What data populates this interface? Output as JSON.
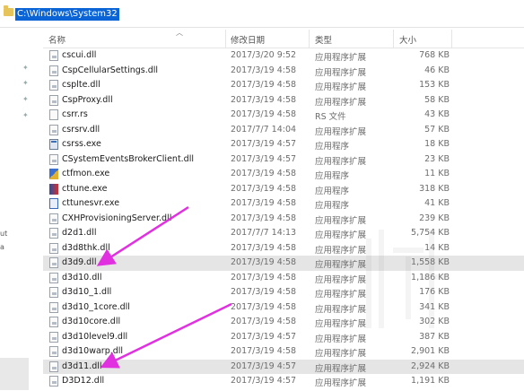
{
  "address": {
    "path": "C:\\Windows\\System32"
  },
  "columns": {
    "name": "名称",
    "date": "修改日期",
    "type": "类型",
    "size": "大小"
  },
  "left_marks": [
    "ut",
    "a"
  ],
  "rows": [
    {
      "name": "cscui.dll",
      "date": "2017/3/20 9:52",
      "type": "应用程序扩展",
      "size": "768 KB",
      "icon": "dll",
      "hl": false
    },
    {
      "name": "CspCellularSettings.dll",
      "date": "2017/3/19 4:58",
      "type": "应用程序扩展",
      "size": "46 KB",
      "icon": "dll",
      "hl": false
    },
    {
      "name": "csplte.dll",
      "date": "2017/3/19 4:58",
      "type": "应用程序扩展",
      "size": "153 KB",
      "icon": "dll",
      "hl": false
    },
    {
      "name": "CspProxy.dll",
      "date": "2017/3/19 4:58",
      "type": "应用程序扩展",
      "size": "58 KB",
      "icon": "dll",
      "hl": false
    },
    {
      "name": "csrr.rs",
      "date": "2017/3/19 4:58",
      "type": "RS 文件",
      "size": "43 KB",
      "icon": "file",
      "hl": false
    },
    {
      "name": "csrsrv.dll",
      "date": "2017/7/7 14:04",
      "type": "应用程序扩展",
      "size": "57 KB",
      "icon": "dll",
      "hl": false
    },
    {
      "name": "csrss.exe",
      "date": "2017/3/19 4:57",
      "type": "应用程序",
      "size": "18 KB",
      "icon": "exe",
      "hl": false
    },
    {
      "name": "CSystemEventsBrokerClient.dll",
      "date": "2017/3/19 4:57",
      "type": "应用程序扩展",
      "size": "23 KB",
      "icon": "dll",
      "hl": false
    },
    {
      "name": "ctfmon.exe",
      "date": "2017/3/19 4:58",
      "type": "应用程序",
      "size": "11 KB",
      "icon": "ctf",
      "hl": false
    },
    {
      "name": "cttune.exe",
      "date": "2017/3/19 4:58",
      "type": "应用程序",
      "size": "318 KB",
      "icon": "tune",
      "hl": false
    },
    {
      "name": "cttunesvr.exe",
      "date": "2017/3/19 4:58",
      "type": "应用程序",
      "size": "41 KB",
      "icon": "blue",
      "hl": false
    },
    {
      "name": "CXHProvisioningServer.dll",
      "date": "2017/3/19 4:58",
      "type": "应用程序扩展",
      "size": "239 KB",
      "icon": "dll",
      "hl": false
    },
    {
      "name": "d2d1.dll",
      "date": "2017/7/7 14:13",
      "type": "应用程序扩展",
      "size": "5,754 KB",
      "icon": "dll",
      "hl": false
    },
    {
      "name": "d3d8thk.dll",
      "date": "2017/3/19 4:58",
      "type": "应用程序扩展",
      "size": "14 KB",
      "icon": "dll",
      "hl": false
    },
    {
      "name": "d3d9.dll",
      "date": "2017/3/19 4:58",
      "type": "应用程序扩展",
      "size": "1,558 KB",
      "icon": "dll",
      "hl": true
    },
    {
      "name": "d3d10.dll",
      "date": "2017/3/19 4:58",
      "type": "应用程序扩展",
      "size": "1,186 KB",
      "icon": "dll",
      "hl": false
    },
    {
      "name": "d3d10_1.dll",
      "date": "2017/3/19 4:58",
      "type": "应用程序扩展",
      "size": "176 KB",
      "icon": "dll",
      "hl": false
    },
    {
      "name": "d3d10_1core.dll",
      "date": "2017/3/19 4:58",
      "type": "应用程序扩展",
      "size": "341 KB",
      "icon": "dll",
      "hl": false
    },
    {
      "name": "d3d10core.dll",
      "date": "2017/3/19 4:58",
      "type": "应用程序扩展",
      "size": "302 KB",
      "icon": "dll",
      "hl": false
    },
    {
      "name": "d3d10level9.dll",
      "date": "2017/3/19 4:57",
      "type": "应用程序扩展",
      "size": "387 KB",
      "icon": "dll",
      "hl": false
    },
    {
      "name": "d3d10warp.dll",
      "date": "2017/3/19 4:58",
      "type": "应用程序扩展",
      "size": "2,901 KB",
      "icon": "dll",
      "hl": false
    },
    {
      "name": "d3d11.dll",
      "date": "2017/3/19 4:57",
      "type": "应用程序扩展",
      "size": "2,924 KB",
      "icon": "dll",
      "hl": true
    },
    {
      "name": "D3D12.dll",
      "date": "2017/3/19 4:57",
      "type": "应用程序扩展",
      "size": "1,191 KB",
      "icon": "dll",
      "hl": false
    }
  ]
}
